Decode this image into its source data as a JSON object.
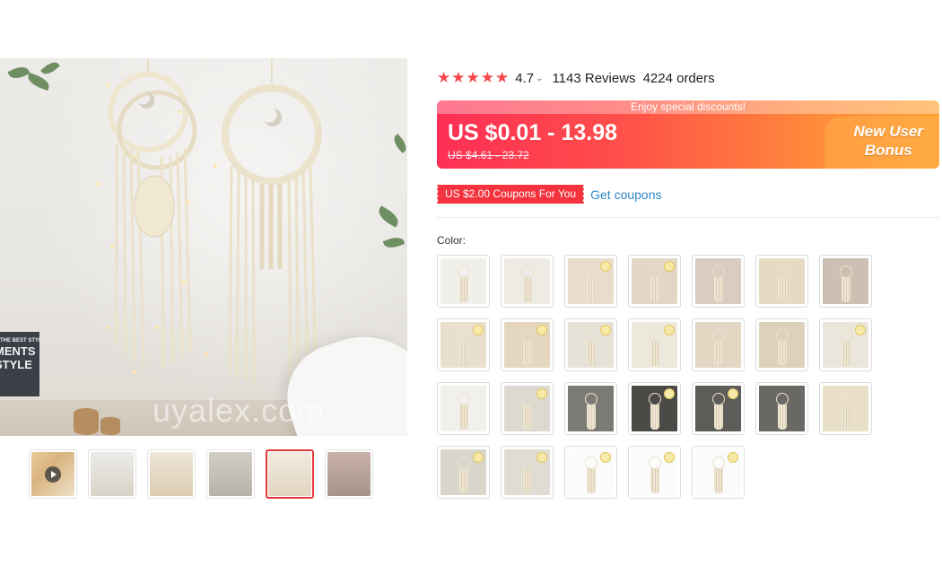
{
  "gallery": {
    "watermark": "uyalex.com",
    "book_lines": [
      "MENTS",
      "STYLE"
    ],
    "book_small": "THE BEST STYLE",
    "thumbnails": [
      {
        "kind": "video",
        "tone": "#dcc9a8"
      },
      {
        "kind": "image",
        "tone": "#d9d4c6"
      },
      {
        "kind": "image",
        "tone": "#e1d4be"
      },
      {
        "kind": "image",
        "tone": "#c7c2b8"
      },
      {
        "kind": "image",
        "tone": "#e7dcc9",
        "active": true
      },
      {
        "kind": "image",
        "tone": "#b9a9a0"
      }
    ]
  },
  "rating": {
    "stars": "★★★★★",
    "value": "4.7",
    "reviews": "1143 Reviews",
    "orders": "4224 orders"
  },
  "price": {
    "banner_note": "Enjoy special discounts!",
    "current": "US $0.01 - 13.98",
    "original": "US $4.61 - 23.72",
    "bonus_line1": "New User",
    "bonus_line2": "Bonus"
  },
  "coupon": {
    "tag": "US $2.00 Coupons For You",
    "link": "Get coupons"
  },
  "color": {
    "label": "Color:",
    "options": [
      {
        "bg": "#f1efea",
        "light": false
      },
      {
        "bg": "#eeebe4",
        "light": false
      },
      {
        "bg": "#e8dccb",
        "light": true
      },
      {
        "bg": "#e2d6c6",
        "light": true
      },
      {
        "bg": "#d8cdc0",
        "light": false
      },
      {
        "bg": "#e6dac4",
        "light": false
      },
      {
        "bg": "#cdbfb2",
        "light": false
      },
      {
        "bg": "#e9dfcd",
        "light": true
      },
      {
        "bg": "#e4d6bf",
        "light": true
      },
      {
        "bg": "#e6e2d8",
        "light": true
      },
      {
        "bg": "#ece8dc",
        "light": true
      },
      {
        "bg": "#e3d7c4",
        "light": false
      },
      {
        "bg": "#ddd1bc",
        "light": false
      },
      {
        "bg": "#eae6dc",
        "light": true
      },
      {
        "bg": "#f2f0ec",
        "light": false
      },
      {
        "bg": "#dcd9d0",
        "light": true
      },
      {
        "bg": "#7c7a74",
        "light": false
      },
      {
        "bg": "#4b4a47",
        "light": true
      },
      {
        "bg": "#5e5c58",
        "light": true
      },
      {
        "bg": "#6a6864",
        "light": false
      },
      {
        "bg": "#eadfc9",
        "light": false
      },
      {
        "bg": "#d9d6cc",
        "light": true
      },
      {
        "bg": "#dfdcd3",
        "light": true
      },
      {
        "bg": "#fbfbfa",
        "light": true
      },
      {
        "bg": "#fbfbfa",
        "light": true
      },
      {
        "bg": "#fbfbfa",
        "light": true
      }
    ]
  }
}
